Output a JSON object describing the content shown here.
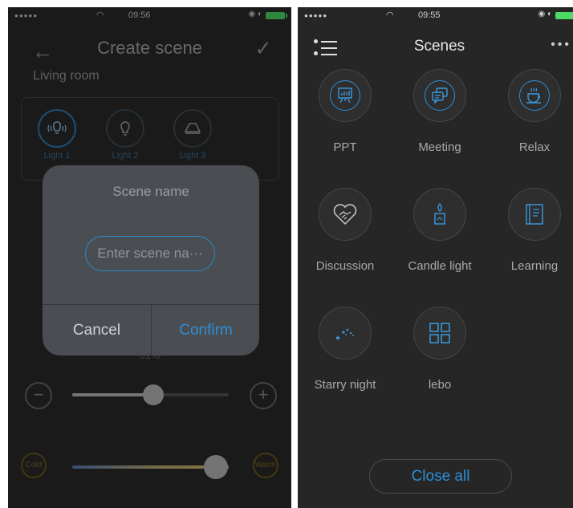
{
  "status": {
    "time_left": "09:56",
    "time_right": "09:55"
  },
  "left": {
    "nav": {
      "back_icon": "back-arrow-icon",
      "title": "Create scene",
      "check_icon": "check-icon"
    },
    "room": "Living room",
    "lights": [
      {
        "label": "Light 1",
        "icon": "bulb-waves-icon"
      },
      {
        "label": "Light 2",
        "icon": "bulb-icon"
      },
      {
        "label": "Light 3",
        "icon": "ceiling-lamp-icon"
      }
    ],
    "brightness_value": "51%",
    "brightness_level": 0.52,
    "temperature_level": 0.92,
    "cold_label": "Cold",
    "warm_label": "Warm",
    "dialog": {
      "title": "Scene name",
      "placeholder": "Enter scene na···",
      "cancel": "Cancel",
      "confirm": "Confirm"
    }
  },
  "right": {
    "title": "Scenes",
    "scenes": [
      {
        "label": "PPT",
        "icon": "presentation-icon"
      },
      {
        "label": "Meeting",
        "icon": "chat-bubbles-icon"
      },
      {
        "label": "Relax",
        "icon": "tea-cup-icon"
      },
      {
        "label": "Discussion",
        "icon": "handshake-heart-icon"
      },
      {
        "label": "Candle light",
        "icon": "candle-icon"
      },
      {
        "label": "Learning",
        "icon": "book-icon"
      },
      {
        "label": "Starry night",
        "icon": "stars-icon"
      },
      {
        "label": "lebo",
        "icon": "grid-icon"
      }
    ],
    "close_all": "Close all"
  },
  "colors": {
    "accent": "#2f8ed6",
    "background": "#262626",
    "dialog": "#4a4e53"
  }
}
